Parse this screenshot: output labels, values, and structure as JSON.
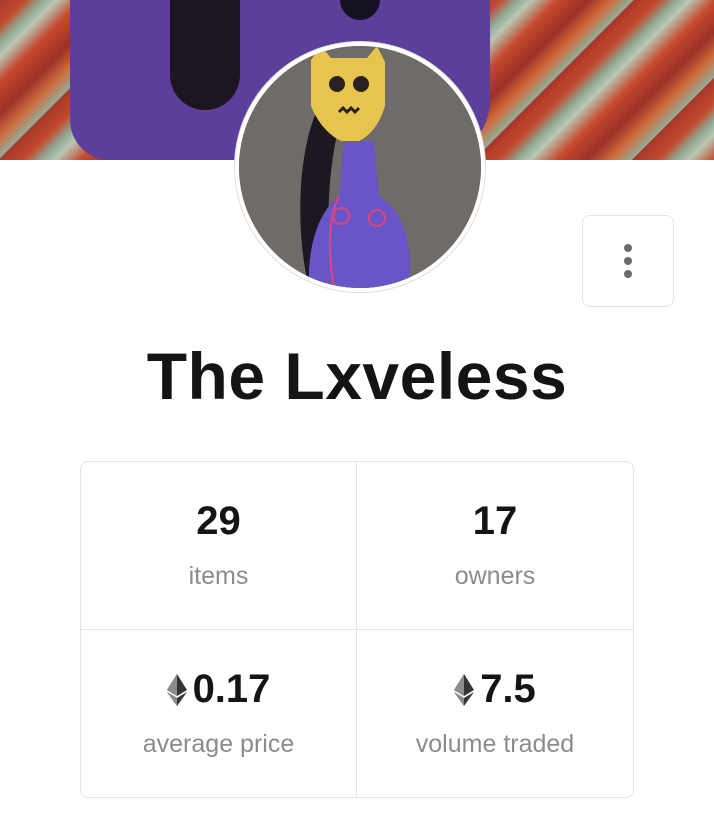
{
  "collection": {
    "name": "The Lxveless"
  },
  "stats": {
    "items": {
      "value": "29",
      "label": "items"
    },
    "owners": {
      "value": "17",
      "label": "owners"
    },
    "average_price": {
      "value": "0.17",
      "label": "average price",
      "currency_icon": "ethereum-icon"
    },
    "volume_traded": {
      "value": "7.5",
      "label": "volume traded",
      "currency_icon": "ethereum-icon"
    }
  },
  "menu": {
    "icon": "more-vertical-icon"
  },
  "colors": {
    "text": "#141414",
    "muted": "#8c8c8c",
    "border": "#e5e5e5"
  }
}
